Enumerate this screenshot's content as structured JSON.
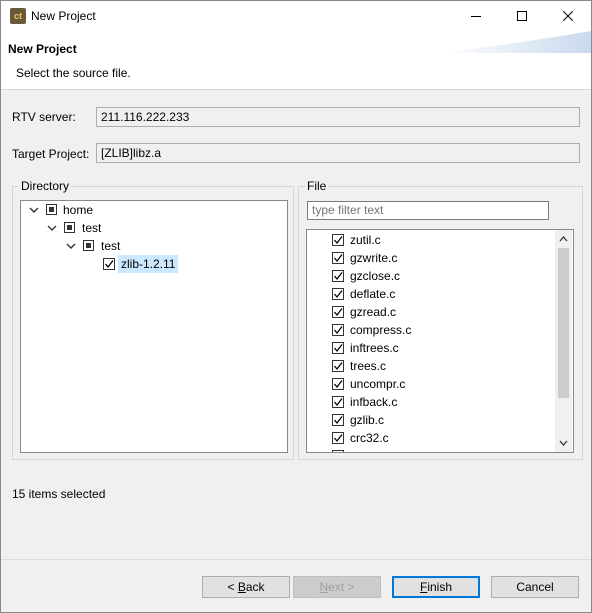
{
  "window": {
    "title": "New Project",
    "icon_text": "ct"
  },
  "header": {
    "title": "New Project",
    "description": "Select the source file."
  },
  "fields": {
    "rtv_server_label": "RTV server:",
    "rtv_server_value": "211.116.222.233",
    "target_project_label": "Target Project:",
    "target_project_value": "[ZLIB]libz.a"
  },
  "directory": {
    "label": "Directory",
    "tree": [
      {
        "label": "home",
        "level": 0,
        "state": "partial",
        "expanded": true
      },
      {
        "label": "test",
        "level": 1,
        "state": "partial",
        "expanded": true
      },
      {
        "label": "test",
        "level": 2,
        "state": "partial",
        "expanded": true
      },
      {
        "label": "zlib-1.2.11",
        "level": 3,
        "state": "checked",
        "selected": true
      }
    ]
  },
  "file": {
    "label": "File",
    "filter_placeholder": "type filter text",
    "items": [
      {
        "name": "zutil.c",
        "checked": true
      },
      {
        "name": "gzwrite.c",
        "checked": true
      },
      {
        "name": "gzclose.c",
        "checked": true
      },
      {
        "name": "deflate.c",
        "checked": true
      },
      {
        "name": "gzread.c",
        "checked": true
      },
      {
        "name": "compress.c",
        "checked": true
      },
      {
        "name": "inftrees.c",
        "checked": true
      },
      {
        "name": "trees.c",
        "checked": true
      },
      {
        "name": "uncompr.c",
        "checked": true
      },
      {
        "name": "infback.c",
        "checked": true
      },
      {
        "name": "gzlib.c",
        "checked": true
      },
      {
        "name": "crc32.c",
        "checked": true
      }
    ]
  },
  "status": "15 items selected",
  "buttons": {
    "back": {
      "mnemonic": "B",
      "rest": "ack",
      "prefix": "< "
    },
    "next": {
      "mnemonic": "N",
      "rest": "ext",
      "suffix": " >"
    },
    "finish": {
      "mnemonic": "F",
      "rest": "inish"
    },
    "cancel": "Cancel"
  },
  "colors": {
    "selection": "#cce8ff",
    "default_button_border": "#0078d7"
  }
}
